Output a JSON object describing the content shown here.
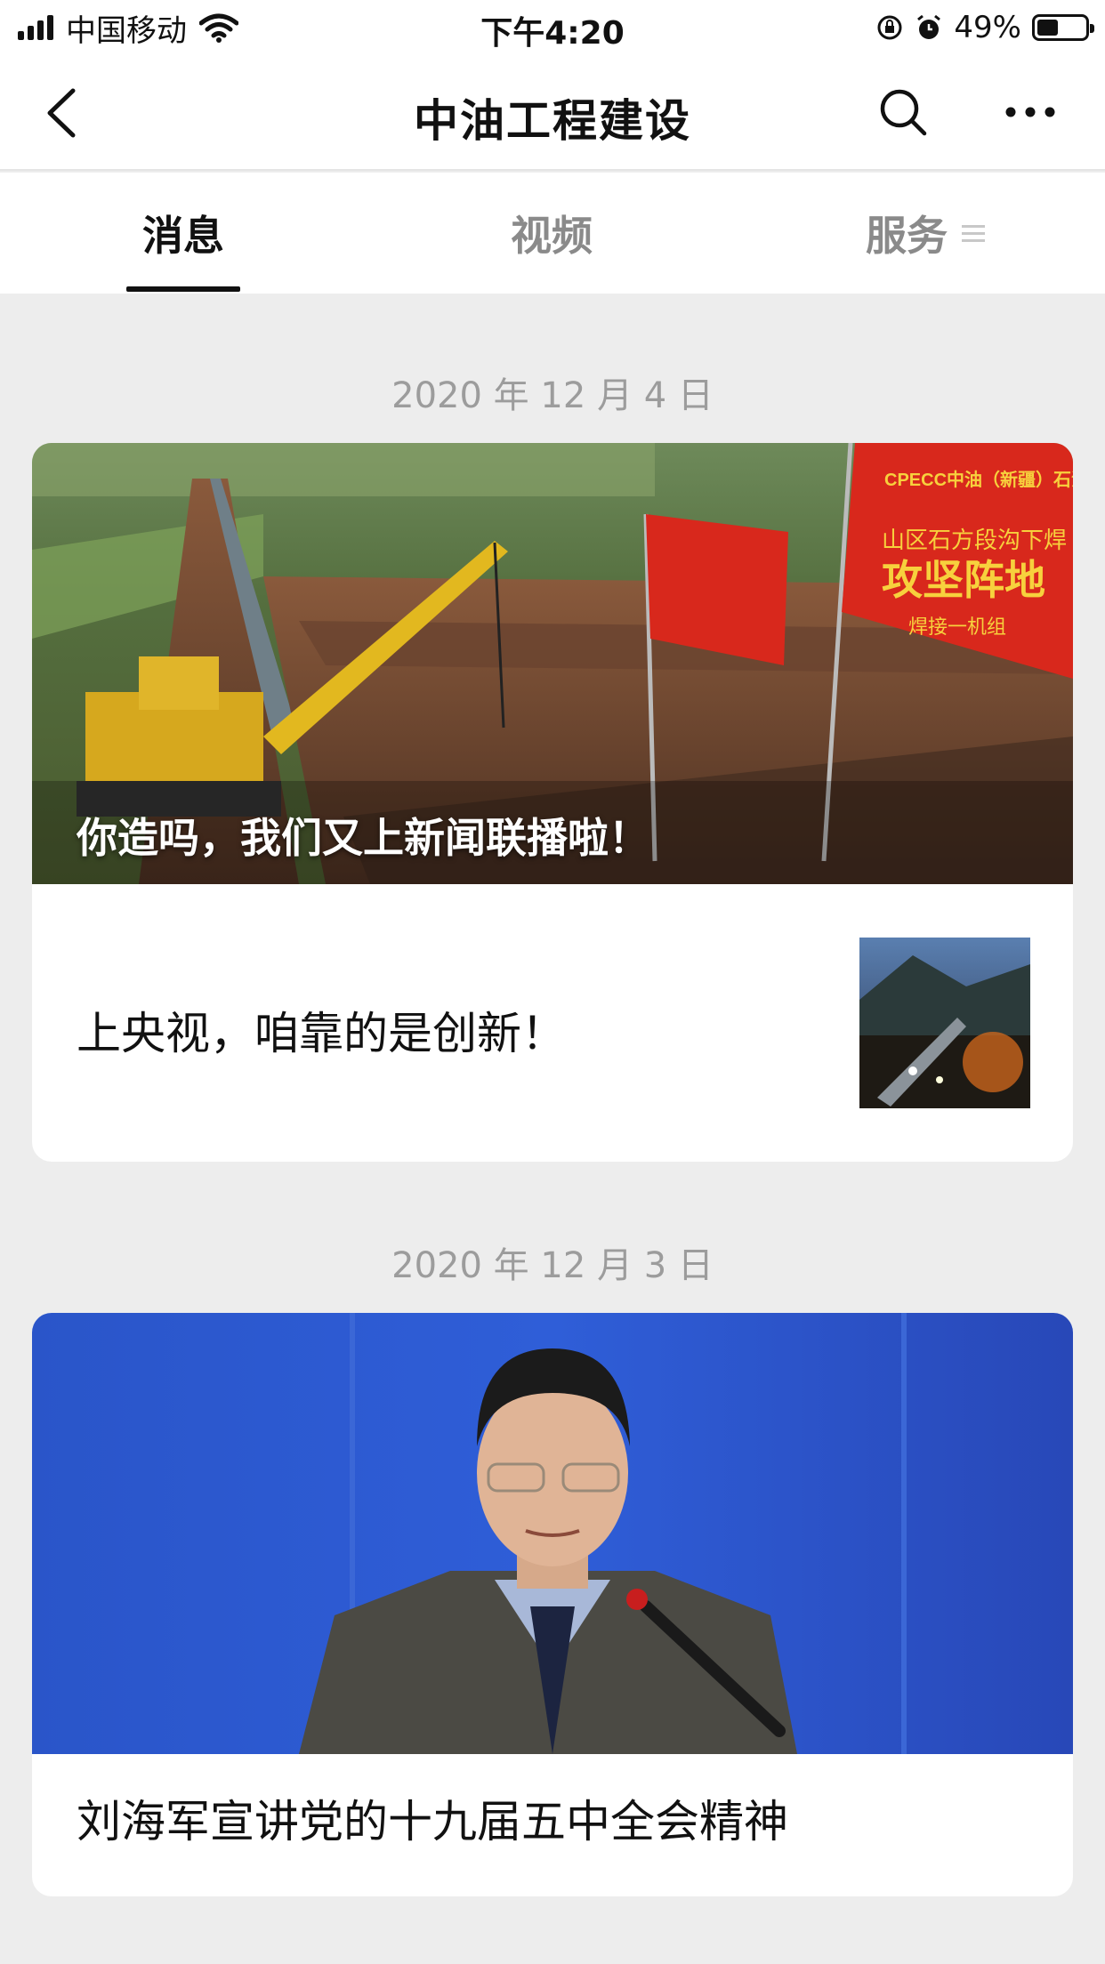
{
  "status_bar": {
    "carrier": "中国移动",
    "time": "下午4:20",
    "battery": "49%",
    "battery_level": 0.49
  },
  "nav": {
    "title": "中油工程建设",
    "back_icon": "chevron-left-icon",
    "search_icon": "search-icon",
    "more_icon": "more-dots-icon"
  },
  "tabs": [
    {
      "label": "消息",
      "active": true
    },
    {
      "label": "视频",
      "active": false
    },
    {
      "label": "服务",
      "active": false
    }
  ],
  "feed": [
    {
      "date": "2020 年 12 月 4 日",
      "cover_caption": "你造吗，我们又上新闻联播啦！",
      "flag_banner": {
        "line1": "CPECC中油（新疆）石油工程",
        "line2": "山区石方段沟下焊",
        "line3": "攻坚阵地",
        "line4": "焊接一机组"
      },
      "sub_title": "上央视，咱靠的是创新！"
    },
    {
      "date": "2020 年 12 月 3 日",
      "title": "刘海军宣讲党的十九届五中全会精神"
    }
  ],
  "colors": {
    "background": "#ededed",
    "card": "#ffffff",
    "date_text": "#9c9c9c",
    "inactive_tab": "#8a8a8a"
  }
}
